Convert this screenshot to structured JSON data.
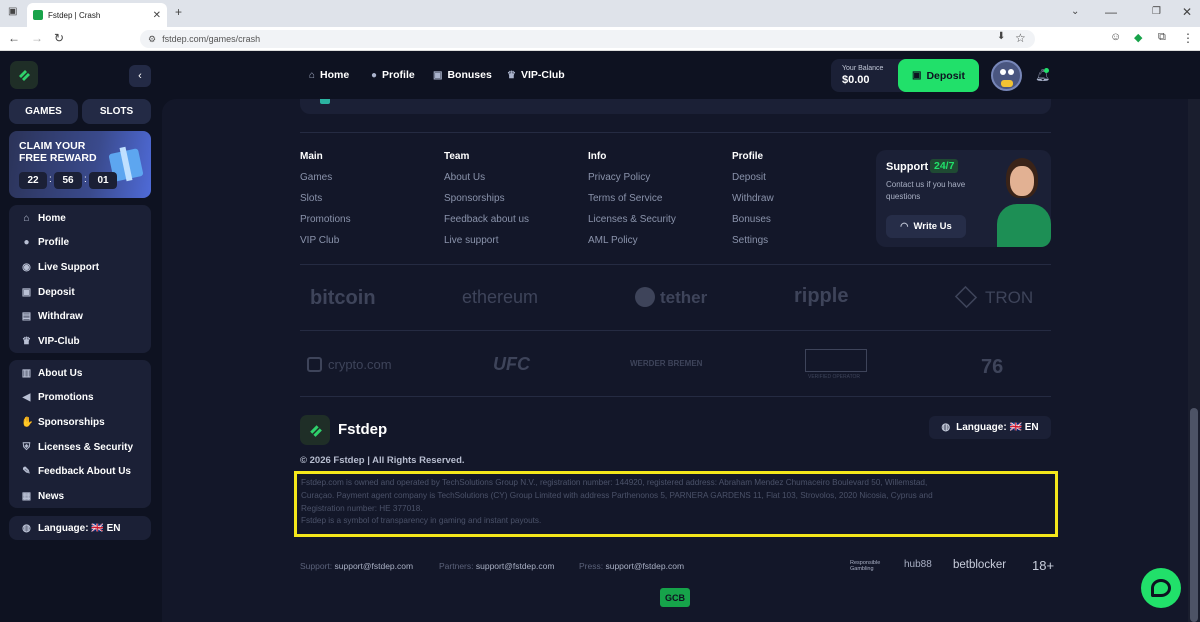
{
  "browser": {
    "tab_title": "Fstdep | Crash",
    "url": "fstdep.com/games/crash"
  },
  "sidebar": {
    "games": "GAMES",
    "slots": "SLOTS",
    "claim": {
      "line1": "CLAIM YOUR",
      "line2": "FREE REWARD",
      "h": "22",
      "m": "56",
      "s": "01"
    },
    "main_items": [
      {
        "label": "Home",
        "icon": "home-icon"
      },
      {
        "label": "Profile",
        "icon": "user-icon"
      },
      {
        "label": "Live Support",
        "icon": "chat-icon"
      },
      {
        "label": "Deposit",
        "icon": "wallet-icon"
      },
      {
        "label": "Withdraw",
        "icon": "withdraw-icon"
      },
      {
        "label": "VIP-Club",
        "icon": "crown-icon"
      }
    ],
    "info_items": [
      {
        "label": "About Us",
        "icon": "book-icon"
      },
      {
        "label": "Promotions",
        "icon": "megaphone-icon"
      },
      {
        "label": "Sponsorships",
        "icon": "handshake-icon"
      },
      {
        "label": "Licenses & Security",
        "icon": "shield-icon"
      },
      {
        "label": "Feedback About Us",
        "icon": "feedback-icon"
      },
      {
        "label": "News",
        "icon": "news-icon"
      }
    ],
    "language": "Language: 🇬🇧 EN"
  },
  "topnav": {
    "home": "Home",
    "profile": "Profile",
    "bonuses": "Bonuses",
    "vip": "VIP-Club",
    "balance_label": "Your Balance",
    "balance": "$0.00",
    "deposit": "Deposit"
  },
  "footer": {
    "columns": [
      {
        "title": "Main",
        "links": [
          "Games",
          "Slots",
          "Promotions",
          "VIP Club"
        ]
      },
      {
        "title": "Team",
        "links": [
          "About Us",
          "Sponsorships",
          "Feedback about us",
          "Live support"
        ]
      },
      {
        "title": "Info",
        "links": [
          "Privacy Policy",
          "Terms of Service",
          "Licenses & Security",
          "AML Policy"
        ]
      },
      {
        "title": "Profile",
        "links": [
          "Deposit",
          "Withdraw",
          "Bonuses",
          "Settings"
        ]
      }
    ],
    "support": {
      "title": "Support",
      "badge": "24/7",
      "text1": "Contact us if you have",
      "text2": "questions",
      "button": "Write Us"
    },
    "partners_row1": [
      "bitcoin",
      "ethereum",
      "tether",
      "ripple",
      "TRON"
    ],
    "partners_row2": [
      "crypto.com",
      "UFC",
      "WERDER BREMEN",
      "VERIFIED OPERATOR",
      "76"
    ],
    "brand": "Fstdep",
    "language": "Language: 🇬🇧 EN",
    "copyright": "© 2026 Fstdep | All Rights Reserved.",
    "legal": [
      "Fstdep.com is owned and operated by TechSolutions Group N.V., registration number: 144920, registered address: Abraham Mendez Chumaceiro Boulevard 50, Willemstad,",
      "Curaçao. Payment agent company is TechSolutions (CY) Group Limited with address Parthenonos 5, PARNERA GARDENS 11, Flat 103, Strovolos, 2020 Nicosia, Cyprus and",
      "Registration number: HE 377018.",
      "Fstdep is a symbol of transparency in gaming and instant payouts."
    ],
    "contacts": {
      "support_label": "Support:",
      "support_email": "support@fstdep.com",
      "partners_label": "Partners:",
      "partners_email": "support@fstdep.com",
      "press_label": "Press:",
      "press_email": "support@fstdep.com"
    },
    "badges": {
      "responsible": "Responsible Gambling",
      "hub88": "hub88",
      "betblocker": "betblocker",
      "age": "18+"
    },
    "gcb": "GCB"
  }
}
